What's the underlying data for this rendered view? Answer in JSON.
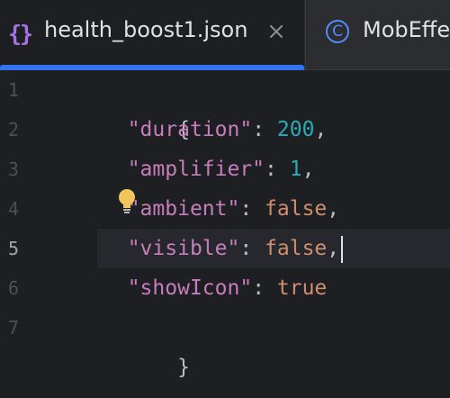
{
  "tabs": [
    {
      "label": "health_boost1.json",
      "icon": "json-file-icon",
      "active": true
    },
    {
      "label": "MobEffe",
      "icon": "class-icon",
      "active": false
    }
  ],
  "icons": {
    "json_glyph": "{}",
    "class_glyph": "C",
    "close": "close-icon",
    "intention": "lightbulb-icon"
  },
  "editor": {
    "line_numbers": [
      "1",
      "2",
      "3",
      "4",
      "5",
      "6",
      "7"
    ],
    "current_line": 5,
    "lines": [
      {
        "open": "{"
      },
      {
        "key": "\"duration\"",
        "sep": ": ",
        "value": "200",
        "trail": ","
      },
      {
        "key": "\"amplifier\"",
        "sep": ": ",
        "value": "1",
        "trail": ","
      },
      {
        "key": "\"ambient\"",
        "sep": ": ",
        "value": "false",
        "trail": ","
      },
      {
        "key": "\"visible\"",
        "sep": ": ",
        "value": "false",
        "trail": ","
      },
      {
        "key": "\"showIcon\"",
        "sep": ": ",
        "value": "true",
        "trail": ""
      },
      {
        "close": "}"
      }
    ]
  },
  "colors": {
    "accent": "#3574f0",
    "key": "#c77dbb",
    "number": "#2aacb8",
    "keyword": "#cf8e6d",
    "json_icon": "#a571e6",
    "bulb": "#f2c55c"
  }
}
